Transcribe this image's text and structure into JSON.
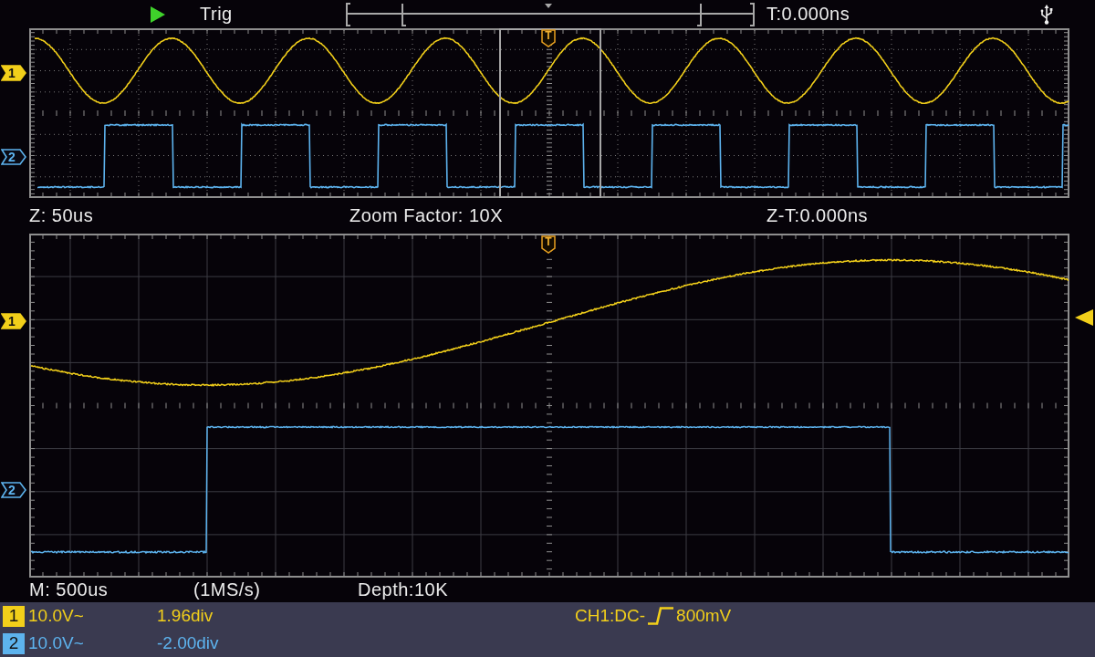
{
  "top_bar": {
    "running": true,
    "trigger_status": "Trig",
    "trigger_time": "T:0.000ns",
    "usb_connected": true
  },
  "overview": {
    "trigger_marker": "T",
    "channel_markers": [
      {
        "label": "1",
        "selected": true
      },
      {
        "label": "2",
        "selected": false
      }
    ]
  },
  "zoom_info": {
    "zoom_timebase": "Z: 50us",
    "zoom_factor": "Zoom Factor: 10X",
    "zoom_trigger_time": "Z-T:0.000ns"
  },
  "zoomed_view": {
    "trigger_marker": "T",
    "channel_markers": [
      {
        "label": "1",
        "selected": true
      },
      {
        "label": "2",
        "selected": false
      }
    ]
  },
  "timebase_info": {
    "main_timebase": "M: 500us",
    "sample_rate": "(1MS/s)",
    "memory_depth": "Depth:10K"
  },
  "channels": [
    {
      "number": "1",
      "color": "#f2cf1a",
      "scale": "10.0V~",
      "offset": "1.96div"
    },
    {
      "number": "2",
      "color": "#5db3ee",
      "scale": "10.0V~",
      "offset": "-2.00div"
    }
  ],
  "trigger": {
    "source": "CH1:DC-",
    "rising_edge": true,
    "level": "800mV"
  }
}
